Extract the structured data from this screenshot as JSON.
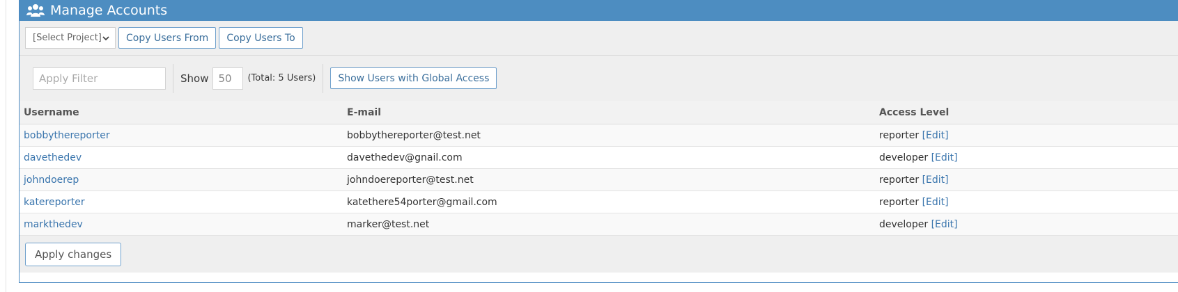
{
  "header": {
    "title": "Manage Accounts",
    "icon": "users-icon"
  },
  "toolbar": {
    "project_select": "[Select Project]",
    "copy_from": "Copy Users From",
    "copy_to": "Copy Users To"
  },
  "filter": {
    "placeholder": "Apply Filter",
    "show_label": "Show",
    "show_value": "50",
    "total": "(Total: 5 Users)",
    "global_button": "Show Users with Global Access"
  },
  "table": {
    "headers": [
      "Username",
      "E-mail",
      "Access Level"
    ],
    "rows": [
      {
        "username": "bobbythereporter",
        "email": "bobbythereporter@test.net",
        "access": "reporter",
        "edit": "[Edit]"
      },
      {
        "username": "davethedev",
        "email": "davethedev@gnail.com",
        "access": "developer",
        "edit": "[Edit]"
      },
      {
        "username": "johndoerep",
        "email": "johndoereporter@test.net",
        "access": "reporter",
        "edit": "[Edit]"
      },
      {
        "username": "katereporter",
        "email": "katethere54porter@gmail.com",
        "access": "reporter",
        "edit": "[Edit]"
      },
      {
        "username": "markthedev",
        "email": "marker@test.net",
        "access": "developer",
        "edit": "[Edit]"
      }
    ]
  },
  "footer": {
    "apply": "Apply changes"
  },
  "colors": {
    "header_bg": "#4d8dc1",
    "link": "#3a75ad",
    "toolbar_bg": "#efefef"
  }
}
